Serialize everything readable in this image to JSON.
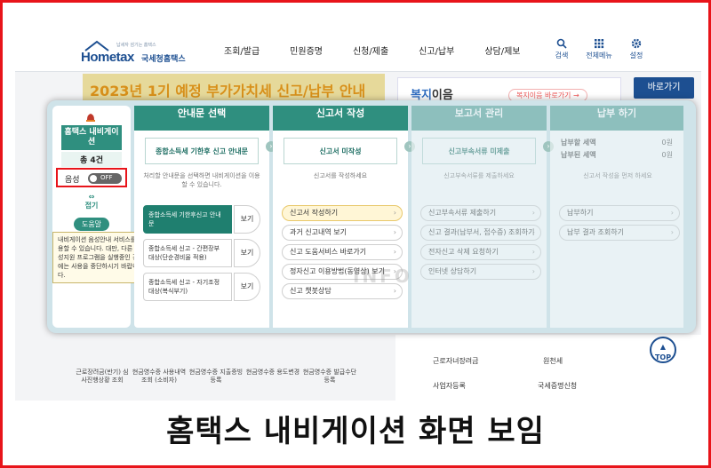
{
  "header": {
    "logo_text": "Hometax",
    "logo_org": "국세청홈택스",
    "logo_slogan": "납세자 섬기는 홈택스",
    "menus": [
      "조회/발급",
      "민원증명",
      "신청/제출",
      "신고/납부",
      "상담/제보"
    ],
    "util": [
      {
        "icon": "search-icon",
        "label": "검색"
      },
      {
        "icon": "grid-icon",
        "label": "전체메뉴"
      },
      {
        "icon": "gear-icon",
        "label": "설정"
      }
    ]
  },
  "background": {
    "banner_text": "2023년 1기 예정 부가가치세 신고/납부 안내",
    "welfare_title_a": "복지",
    "welfare_title_b": "이음",
    "welfare_link": "복지이음 바로가기 →",
    "goto_button": "바로가기",
    "right_links": [
      "근로자녀장려금",
      "원천세",
      "사업자등록",
      "국세증명신청"
    ],
    "top_button": "TOP",
    "footer_links": [
      "근로장려금(반기) 심사진행상황 조회",
      "현금영수증 사용내역조회 (소비자)",
      "현금영수증 지출증빙 등록",
      "현금영수증 용도변경",
      "현금영수증 발급수단 등록"
    ]
  },
  "navigation": {
    "side_title": "홈택스 내비게이션",
    "count_label": "총 4건",
    "sound_label": "음성",
    "sound_state": "OFF",
    "fold_label": "접기",
    "help_label": "도움말",
    "tooltip": "내비게이션 음성안내 서비스를 이용할 수 있습니다. 대만, 다른 음성지원 프로그램을 실행중인 경우에는 사용을 중단하시기 바랍니다.",
    "columns": {
      "guide": {
        "title": "안내문 선택",
        "selected": "종합소득세 기한후 신고 안내문",
        "hint": "처리할 안내문을 선택하면 내비게이션을 이용할 수 있습니다.",
        "items": [
          {
            "label": "종합소득세 기한후신고 안내문",
            "view": "보기"
          },
          {
            "label": "종합소득세 신고 - 간편장부 대상(단순경비율 적용)",
            "view": "보기"
          },
          {
            "label": "종합소득세 신고 - 자기조정 대상(복식부기)",
            "view": "보기"
          }
        ]
      },
      "report": {
        "title": "신고서 작성",
        "selected": "신고서 미작성",
        "hint": "신고서를 작성하세요",
        "options": [
          "신고서 작성하기",
          "과거 신고내역 보기",
          "신고 도움서비스 바로가기",
          "정자신고 이용방법(동영상) 보기",
          "신고 챗봇상담"
        ]
      },
      "docs": {
        "title": "보고서 관리",
        "selected": "신고부속서류 미제출",
        "hint": "신고부속서류를 제출하세요",
        "options": [
          "신고부속서류 제출하기",
          "신고 결과(납부서, 접수증) 조회하기",
          "전자신고 삭제 요청하기",
          "인터넷 상담하기"
        ]
      },
      "pay": {
        "title": "납부 하기",
        "rows": [
          {
            "label": "납부할 세액",
            "value": "0원"
          },
          {
            "label": "납부된 세액",
            "value": "0원"
          }
        ],
        "hint": "신고서 작성을 먼저 하세요",
        "options": [
          "납부하기",
          "납부 결과 조회하기"
        ]
      }
    }
  },
  "watermark": "INFO",
  "caption": "홈택스 내비게이션 화면 보임"
}
